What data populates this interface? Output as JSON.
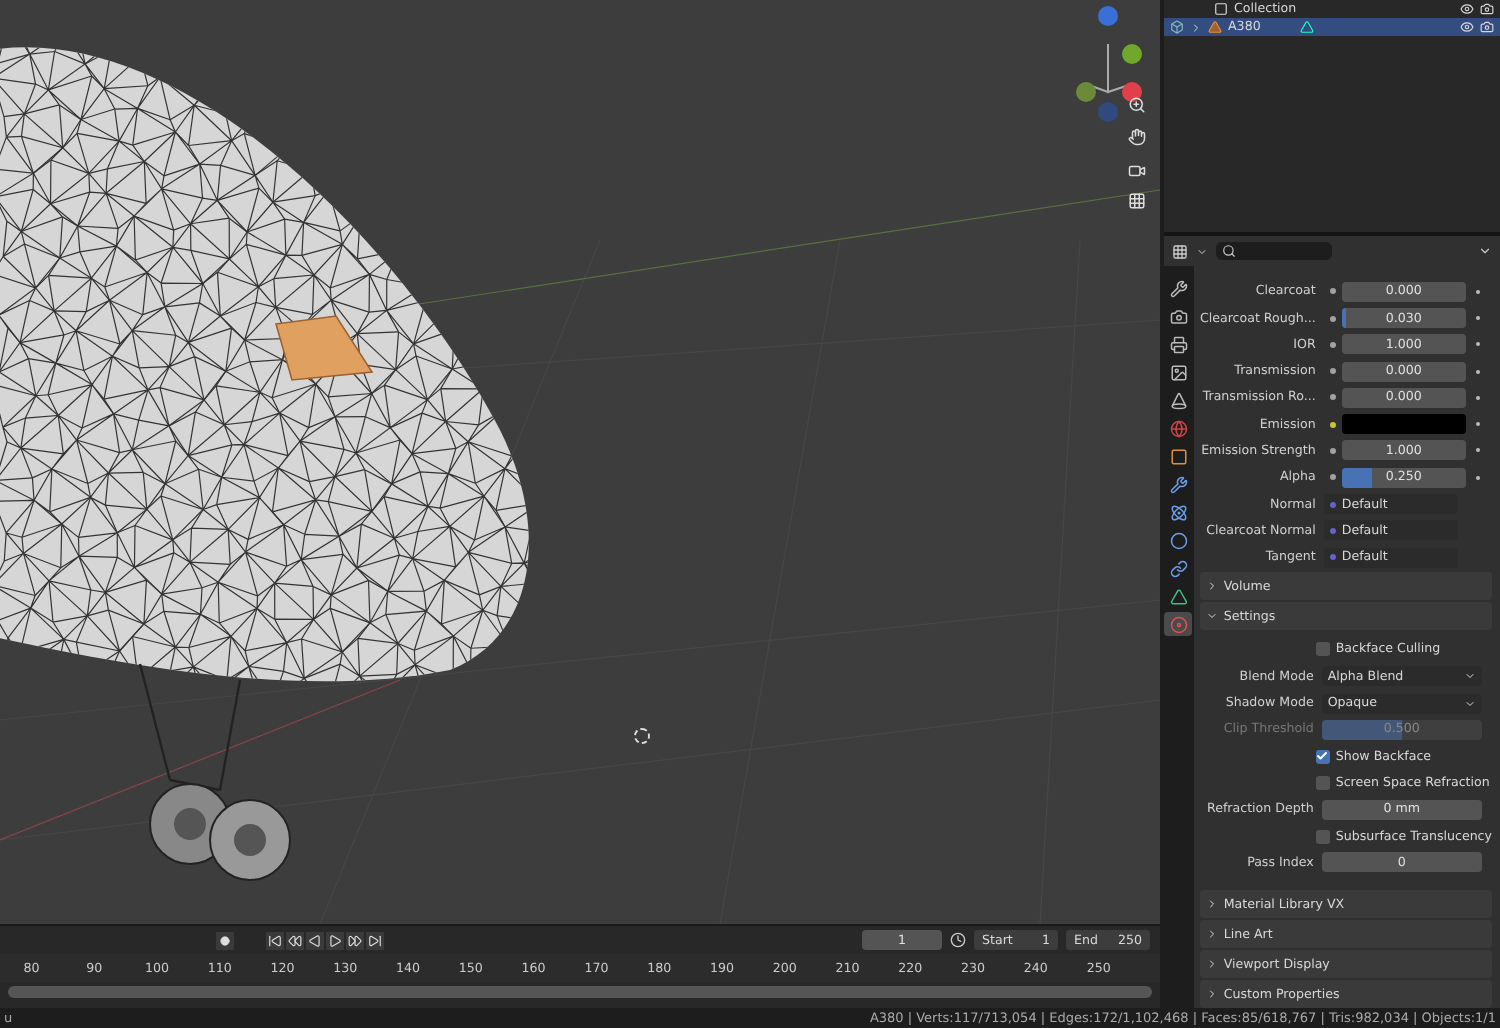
{
  "outliner": {
    "items": [
      {
        "name": "Collection",
        "kind": "collection",
        "selected": false
      },
      {
        "name": "A380",
        "kind": "object",
        "selected": true
      }
    ]
  },
  "properties": {
    "tabs": [
      {
        "kind": "tool",
        "selected": false
      },
      {
        "kind": "render",
        "selected": false
      },
      {
        "kind": "output",
        "selected": false
      },
      {
        "kind": "view",
        "selected": false
      },
      {
        "kind": "scene",
        "selected": false
      },
      {
        "kind": "world",
        "selected": false
      },
      {
        "kind": "object",
        "selected": false
      },
      {
        "kind": "modifier",
        "selected": false
      },
      {
        "kind": "particles",
        "selected": false
      },
      {
        "kind": "physics",
        "selected": false
      },
      {
        "kind": "constraints",
        "selected": false
      },
      {
        "kind": "data",
        "selected": false
      },
      {
        "kind": "material",
        "selected": true
      }
    ],
    "rows": [
      {
        "label": "Clearcoat",
        "kind": "slider",
        "value": "0.000",
        "level": 0
      },
      {
        "label": "Clearcoat Rough...",
        "kind": "slider",
        "value": "0.030",
        "level": 0.03
      },
      {
        "label": "IOR",
        "kind": "slider",
        "value": "1.000",
        "level": 0
      },
      {
        "label": "Transmission",
        "kind": "slider",
        "value": "0.000",
        "level": 0
      },
      {
        "label": "Transmission Ro...",
        "kind": "slider",
        "value": "0.000",
        "level": 0
      },
      {
        "label": "Emission",
        "kind": "color",
        "color": "#000000"
      },
      {
        "label": "Emission Strength",
        "kind": "slider",
        "value": "1.000",
        "level": 0
      },
      {
        "label": "Alpha",
        "kind": "slider",
        "value": "0.250",
        "level": 0.25
      },
      {
        "label": "Normal",
        "kind": "link",
        "value": "Default"
      },
      {
        "label": "Clearcoat Normal",
        "kind": "link",
        "value": "Default"
      },
      {
        "label": "Tangent",
        "kind": "link",
        "value": "Default"
      }
    ],
    "sections": [
      {
        "title": "Volume",
        "expanded": false
      },
      {
        "title": "Settings",
        "expanded": true,
        "rows": [
          {
            "kind": "checkbox",
            "label": "Backface Culling",
            "checked": false
          },
          {
            "kind": "dropdown",
            "label": "Blend Mode",
            "value": "Alpha Blend"
          },
          {
            "kind": "dropdown",
            "label": "Shadow Mode",
            "value": "Opaque"
          },
          {
            "kind": "slider",
            "label": "Clip Threshold",
            "value": "0.500",
            "level": 0.5,
            "disabled": true
          },
          {
            "kind": "checkbox",
            "label": "Show Backface",
            "checked": true
          },
          {
            "kind": "checkbox",
            "label": "Screen Space Refraction",
            "checked": false
          },
          {
            "kind": "field",
            "label": "Refraction Depth",
            "value": "0 mm"
          },
          {
            "kind": "checkbox",
            "label": "Subsurface Translucency",
            "checked": false
          },
          {
            "kind": "field",
            "label": "Pass Index",
            "value": "0"
          }
        ]
      },
      {
        "title": "Material Library VX",
        "expanded": false
      },
      {
        "title": "Line Art",
        "expanded": false
      },
      {
        "title": "Viewport Display",
        "expanded": false
      },
      {
        "title": "Custom Properties",
        "expanded": false
      }
    ]
  },
  "timeline": {
    "current_frame": "1",
    "start_label": "Start",
    "start": "1",
    "end_label": "End",
    "end": "250",
    "ticks": [
      "80",
      "90",
      "100",
      "110",
      "120",
      "130",
      "140",
      "150",
      "160",
      "170",
      "180",
      "190",
      "200",
      "210",
      "220",
      "230",
      "240",
      "250"
    ]
  },
  "status_bar": {
    "left": "u",
    "right": "A380 | Verts:117/713,054 | Edges:172/1,102,468 | Faces:85/618,767 | Tris:982,034 | Objects:1/1"
  }
}
